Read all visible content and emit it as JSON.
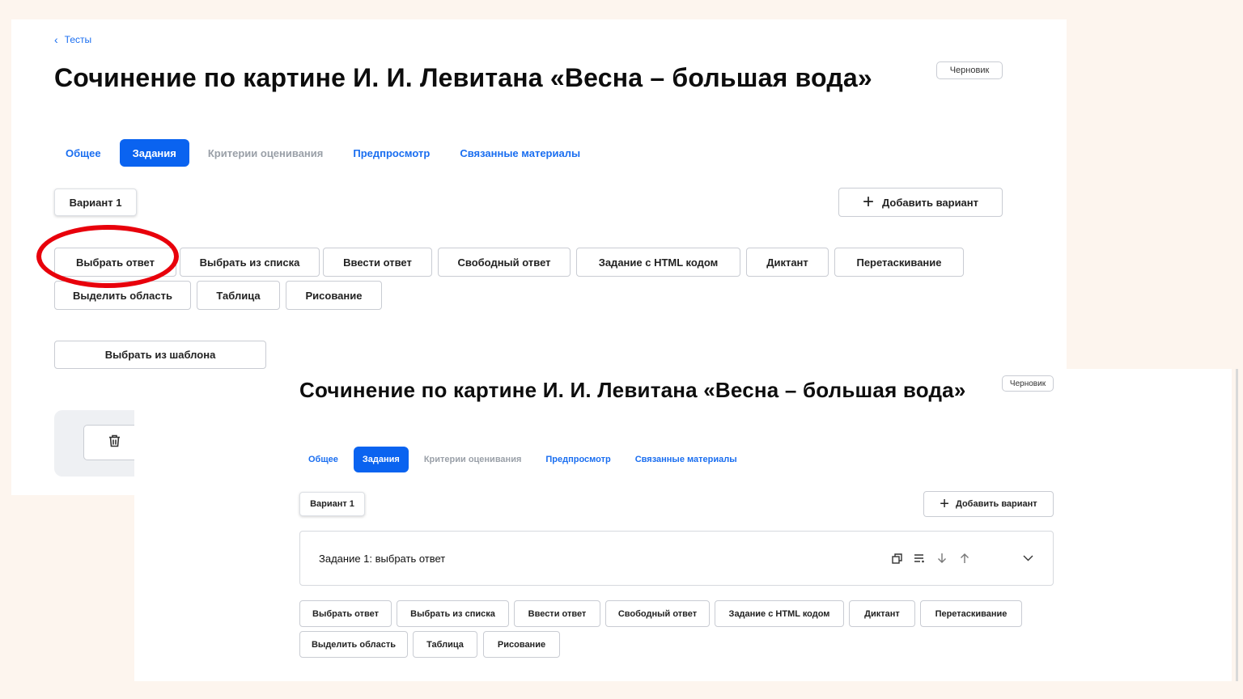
{
  "back_link": "Тесты",
  "page_title": "Сочинение по картине И. И. Левитана «Весна – большая вода»",
  "status_badge": "Черновик",
  "tabs": [
    {
      "label": "Общее",
      "state": "normal"
    },
    {
      "label": "Задания",
      "state": "active"
    },
    {
      "label": "Критерии оценивания",
      "state": "disabled"
    },
    {
      "label": "Предпросмотр",
      "state": "normal"
    },
    {
      "label": "Связанные материалы",
      "state": "normal"
    }
  ],
  "variant_label": "Вариант 1",
  "add_variant_label": "Добавить вариант",
  "task_types": [
    "Выбрать ответ",
    "Выбрать из списка",
    "Ввести ответ",
    "Свободный ответ",
    "Задание с HTML кодом",
    "Диктант",
    "Перетаскивание",
    "Выделить область",
    "Таблица",
    "Рисование"
  ],
  "template_button": "Выбрать из шаблона",
  "task_card": {
    "title": "Задание 1: выбрать ответ"
  },
  "colors": {
    "accent": "#0a63f0",
    "link": "#1a6ef0",
    "highlight": "#e8000b",
    "background": "#fdf5ee"
  },
  "icons": [
    "chevron-left-icon",
    "plus-icon",
    "trash-icon",
    "copy-icon",
    "list-settings-icon",
    "arrow-down-icon",
    "arrow-up-icon",
    "chevron-down-icon"
  ]
}
